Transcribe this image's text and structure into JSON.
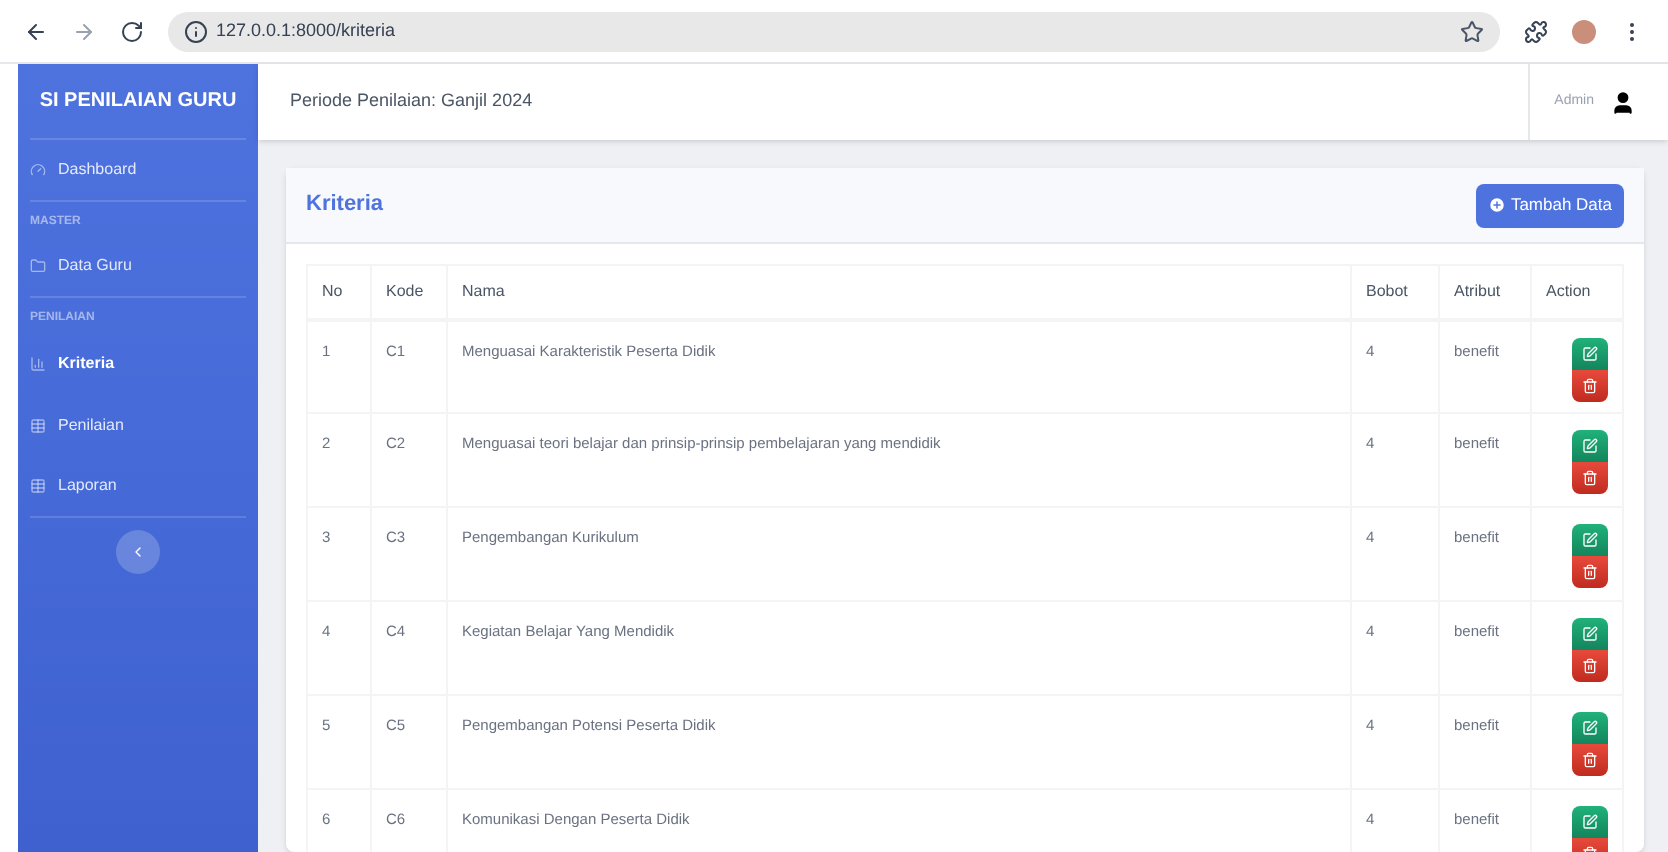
{
  "browser": {
    "url": "127.0.0.1:8000/kriteria"
  },
  "sidebar": {
    "brand": "SI PENILAIAN GURU",
    "items": [
      {
        "kind": "link",
        "label": "Dashboard",
        "selected": false
      },
      {
        "kind": "heading",
        "label": "MASTER"
      },
      {
        "kind": "link",
        "label": "Data Guru",
        "selected": false
      },
      {
        "kind": "heading",
        "label": "PENILAIAN"
      },
      {
        "kind": "link",
        "label": "Kriteria",
        "selected": true
      },
      {
        "kind": "link",
        "label": "Penilaian",
        "selected": false
      },
      {
        "kind": "link",
        "label": "Laporan",
        "selected": false
      }
    ]
  },
  "topbar": {
    "period": "Periode Penilaian: Ganjil 2024",
    "user": "Admin"
  },
  "card": {
    "title": "Kriteria",
    "add_button": "Tambah Data"
  },
  "table": {
    "columns": [
      "No",
      "Kode",
      "Nama",
      "Bobot",
      "Atribut",
      "Action"
    ],
    "rows": [
      {
        "no": "1",
        "kode": "C1",
        "nama": "Menguasai Karakteristik Peserta Didik",
        "bobot": "4",
        "atribut": "benefit"
      },
      {
        "no": "2",
        "kode": "C2",
        "nama": "Menguasai teori belajar dan prinsip-prinsip pembelajaran yang mendidik",
        "bobot": "4",
        "atribut": "benefit"
      },
      {
        "no": "3",
        "kode": "C3",
        "nama": "Pengembangan Kurikulum",
        "bobot": "4",
        "atribut": "benefit"
      },
      {
        "no": "4",
        "kode": "C4",
        "nama": "Kegiatan Belajar Yang Mendidik",
        "bobot": "4",
        "atribut": "benefit"
      },
      {
        "no": "5",
        "kode": "C5",
        "nama": "Pengembangan Potensi Peserta Didik",
        "bobot": "4",
        "atribut": "benefit"
      },
      {
        "no": "6",
        "kode": "C6",
        "nama": "Komunikasi Dengan Peserta Didik",
        "bobot": "4",
        "atribut": "benefit"
      }
    ]
  }
}
